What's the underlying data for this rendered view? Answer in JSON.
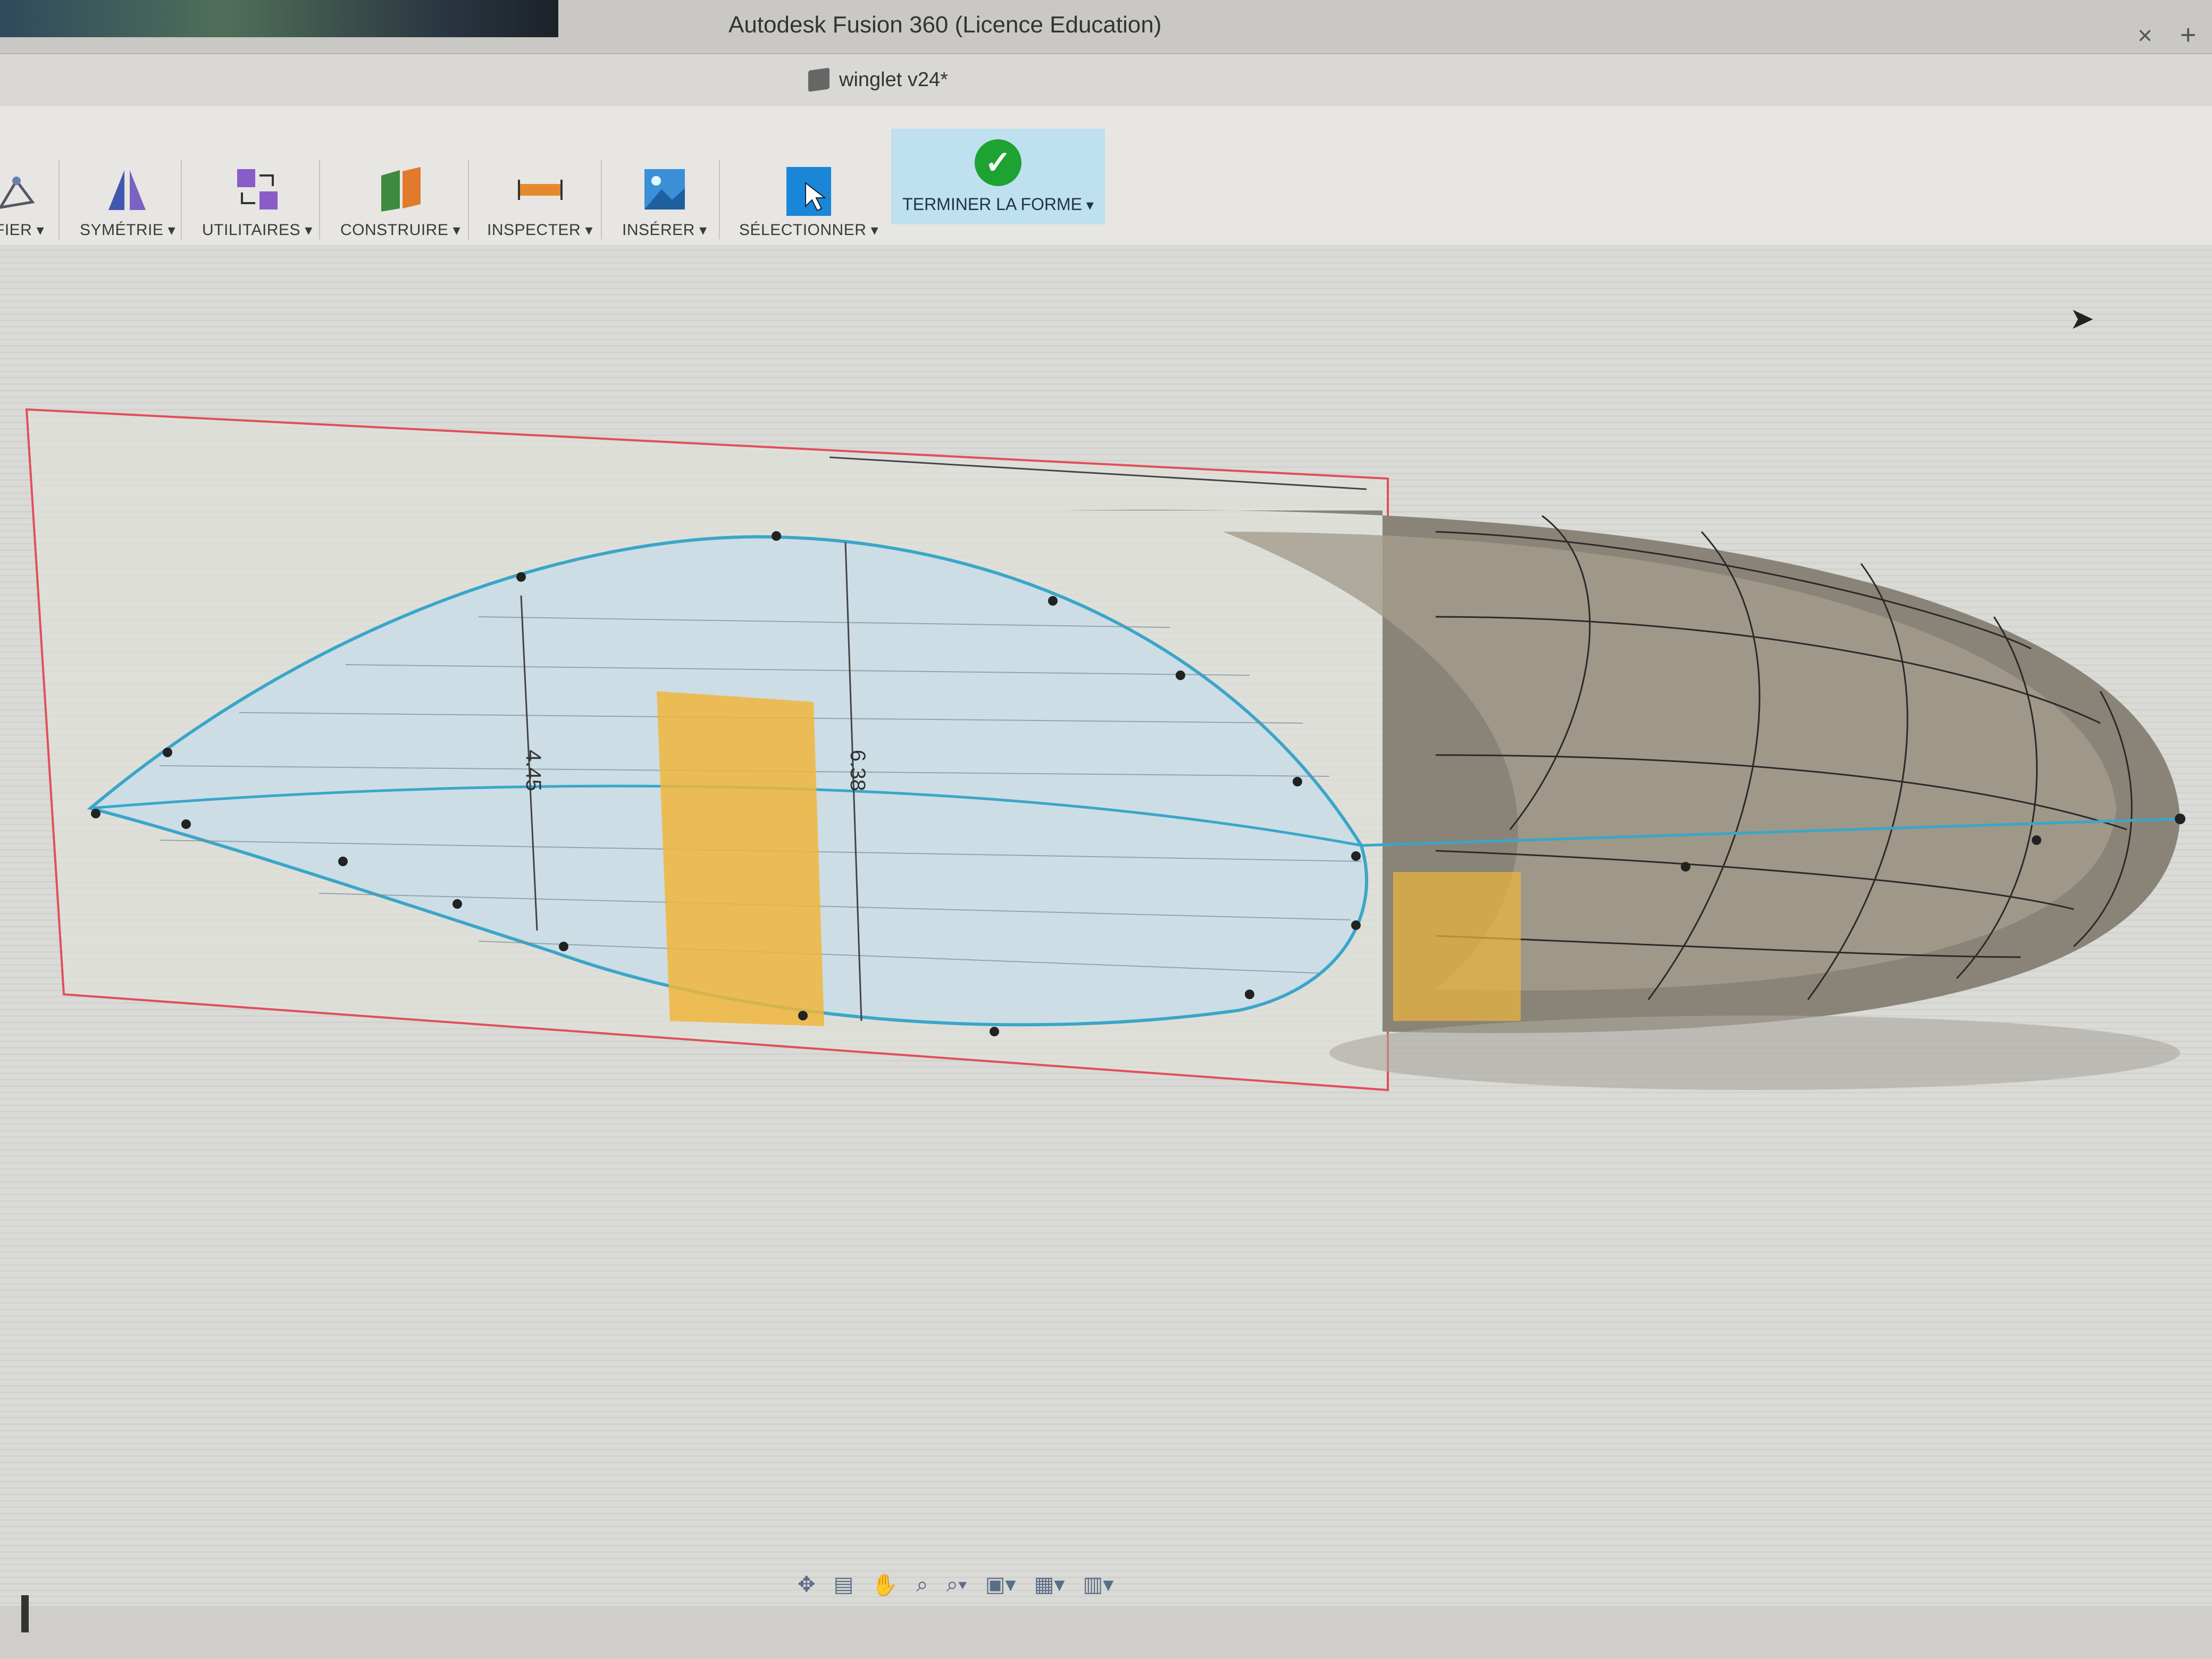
{
  "window": {
    "title": "Autodesk Fusion 360 (Licence Education)",
    "document_tab": "winglet v24*",
    "close_glyph": "×",
    "add_glyph": "+"
  },
  "toolbar": {
    "items": [
      {
        "label": "FIER",
        "icon": "modify-icon"
      },
      {
        "label": "SYMÉTRIE",
        "icon": "symmetry-icon"
      },
      {
        "label": "UTILITAIRES",
        "icon": "utilities-icon"
      },
      {
        "label": "CONSTRUIRE",
        "icon": "construct-icon"
      },
      {
        "label": "INSPECTER",
        "icon": "inspect-icon"
      },
      {
        "label": "INSÉRER",
        "icon": "insert-icon"
      },
      {
        "label": "SÉLECTIONNER",
        "icon": "select-icon"
      }
    ],
    "finish": {
      "label": "TERMINER LA FORME",
      "icon": "checkmark-icon",
      "color": "#1ea232",
      "bg": "#bfe0ee"
    }
  },
  "viewport": {
    "model": "winglet",
    "sketch_dimensions": [
      "4.45",
      "6.38"
    ],
    "accent_outline": "#3aa6c8",
    "highlight_face": "#f0b63c",
    "plane_border": "#e0505a"
  },
  "navbar": {
    "icons": [
      "orbit-icon",
      "pan-icon",
      "hand-icon",
      "zoom-icon",
      "zoom-window-icon",
      "display-icon",
      "grid-icon",
      "viewport-icon"
    ]
  }
}
